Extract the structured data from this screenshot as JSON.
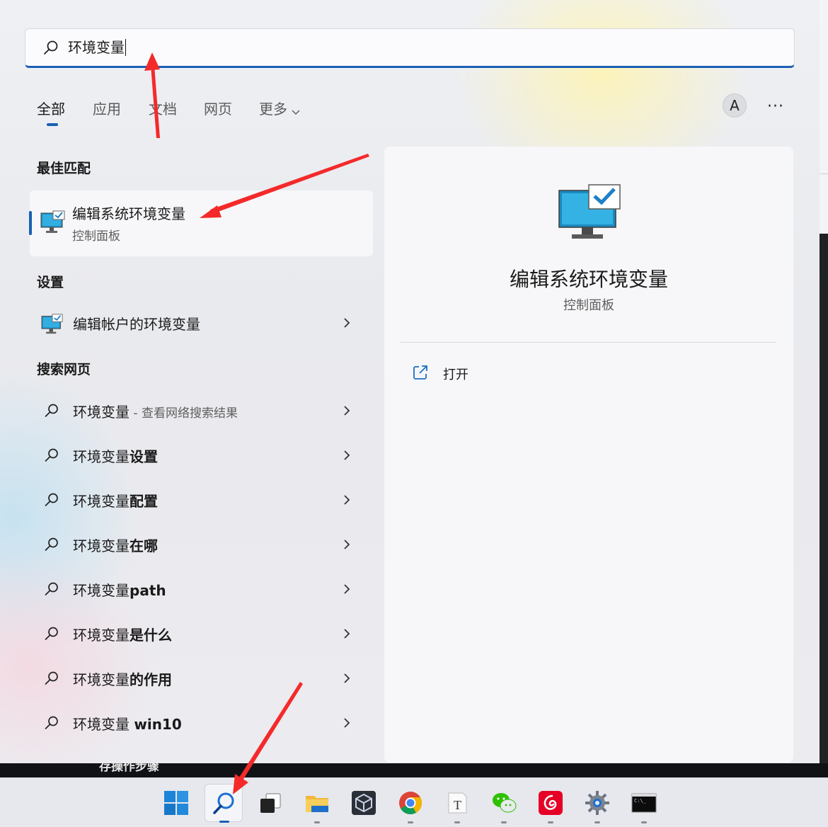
{
  "search": {
    "value": "环境变量"
  },
  "tabs": [
    {
      "label": "全部",
      "active": true
    },
    {
      "label": "应用"
    },
    {
      "label": "文档"
    },
    {
      "label": "网页"
    },
    {
      "label": "更多"
    }
  ],
  "header": {
    "avatar_letter": "A",
    "more_label": "···"
  },
  "sections": {
    "best_match": "最佳匹配",
    "settings": "设置",
    "web": "搜索网页"
  },
  "best_match": {
    "title": "编辑系统环境变量",
    "subtitle": "控制面板",
    "icon": "computer-monitor-check-icon"
  },
  "settings_items": [
    {
      "label": "编辑帐户的环境变量",
      "icon": "computer-monitor-check-icon"
    }
  ],
  "web_results": [
    {
      "prefix": "环境变量",
      "suffix": "",
      "hint": " - 查看网络搜索结果"
    },
    {
      "prefix": "环境变量",
      "suffix": "设置",
      "hint": ""
    },
    {
      "prefix": "环境变量",
      "suffix": "配置",
      "hint": ""
    },
    {
      "prefix": "环境变量",
      "suffix": "在哪",
      "hint": ""
    },
    {
      "prefix": "环境变量",
      "suffix": "path",
      "hint": ""
    },
    {
      "prefix": "环境变量",
      "suffix": "是什么",
      "hint": ""
    },
    {
      "prefix": "环境变量",
      "suffix": "的作用",
      "hint": ""
    },
    {
      "prefix": "环境变量 ",
      "suffix": "win10",
      "hint": ""
    }
  ],
  "detail": {
    "title": "编辑系统环境变量",
    "subtitle": "控制面板",
    "open_label": "打开"
  },
  "background": {
    "partial_text": "存操作步骤"
  },
  "taskbar": {
    "apps": [
      {
        "name": "start",
        "icon": "windows-logo-icon"
      },
      {
        "name": "search",
        "icon": "search-icon",
        "active": true
      },
      {
        "name": "task-view",
        "icon": "task-view-icon"
      },
      {
        "name": "file-explorer",
        "icon": "folder-icon"
      },
      {
        "name": "virtualbox",
        "icon": "cube-icon"
      },
      {
        "name": "chrome",
        "icon": "chrome-icon"
      },
      {
        "name": "typora",
        "icon": "typora-icon"
      },
      {
        "name": "wechat",
        "icon": "wechat-icon"
      },
      {
        "name": "netease-music",
        "icon": "netease-music-icon"
      },
      {
        "name": "settings",
        "icon": "gear-icon"
      },
      {
        "name": "terminal",
        "icon": "terminal-icon"
      }
    ]
  },
  "colors": {
    "accent": "#1a5fb4",
    "annotation": "#f42a2a"
  }
}
